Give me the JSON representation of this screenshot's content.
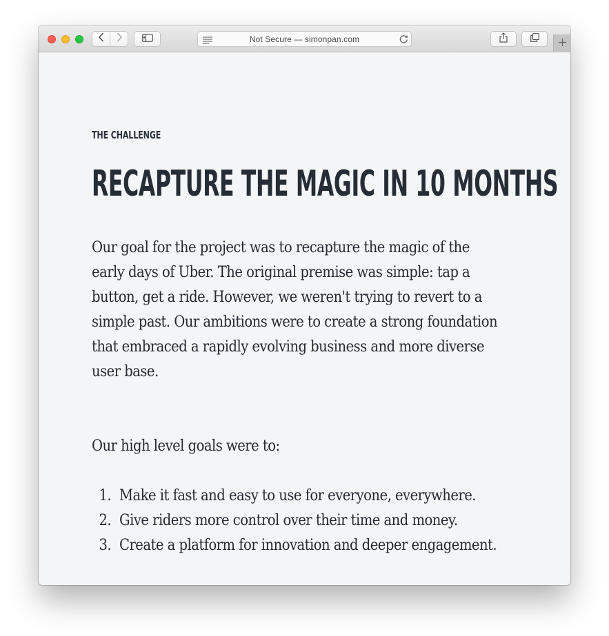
{
  "browser": {
    "address_bar": "Not Secure — simonpan.com",
    "icons": [
      "back-icon",
      "forward-icon",
      "sidebar-icon",
      "reader-icon",
      "reload-icon",
      "share-icon",
      "tabs-icon",
      "plus-icon"
    ]
  },
  "page": {
    "eyebrow": "THE CHALLENGE",
    "headline": "RECAPTURE THE MAGIC IN 10 MONTHS",
    "paragraph1_lines": [
      "Our goal for the project was to recapture the magic of the",
      "early days of Uber. The original premise was simple: tap a",
      "button, get a ride. However, we weren't trying to revert to a",
      "simple past. Our ambitions were to create a strong foundation",
      "that embraced a rapidly evolving business and more diverse",
      "user base."
    ],
    "paragraph2": "Our high level goals were to:",
    "goals": [
      {
        "num": "1.",
        "text": "Make it fast and easy to use for everyone, everywhere."
      },
      {
        "num": "2.",
        "text": "Give riders more control over their time and money."
      },
      {
        "num": "3.",
        "text": "Create a platform for innovation and deeper engagement."
      }
    ]
  }
}
